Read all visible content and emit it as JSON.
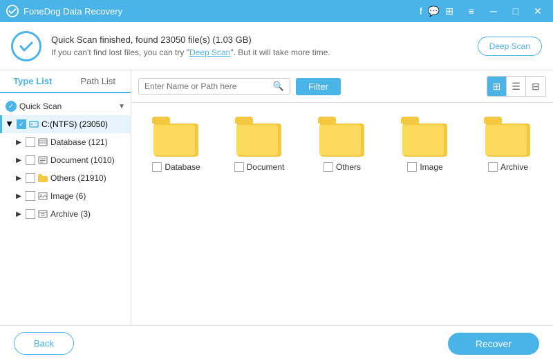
{
  "app": {
    "title": "FoneDog Data Recovery",
    "title_icon": "●"
  },
  "titlebar": {
    "fb_icon": "f",
    "msg_icon": "💬",
    "grid_icon": "⊞",
    "menu_icon": "≡",
    "min_icon": "─",
    "max_icon": "□",
    "close_icon": "✕"
  },
  "header": {
    "status_title": "Quick Scan finished, found 23050 file(s) (1.03 GB)",
    "status_subtitle_pre": "If you can't find lost files, you can try \"",
    "status_link": "Deep Scan",
    "status_subtitle_post": "\". But it will take more time.",
    "deep_scan_label": "Deep Scan"
  },
  "sidebar": {
    "tab_type": "Type List",
    "tab_path": "Path List",
    "quick_scan_label": "Quick Scan",
    "drive_label": "C:(NTFS) (23050)",
    "items": [
      {
        "label": "Database (121)",
        "type": "hdd"
      },
      {
        "label": "Document (1010)",
        "type": "hdd"
      },
      {
        "label": "Others (21910)",
        "type": "folder"
      },
      {
        "label": "Image (6)",
        "type": "photo"
      },
      {
        "label": "Archive (3)",
        "type": "hdd"
      }
    ]
  },
  "toolbar": {
    "search_placeholder": "Enter Name or Path here",
    "filter_label": "Filter",
    "view_grid_icon": "⊞",
    "view_list_icon": "☰",
    "view_detail_icon": "⊟"
  },
  "files": [
    {
      "name": "Database"
    },
    {
      "name": "Document"
    },
    {
      "name": "Others"
    },
    {
      "name": "Image"
    },
    {
      "name": "Archive"
    }
  ],
  "footer": {
    "back_label": "Back",
    "recover_label": "Recover"
  }
}
